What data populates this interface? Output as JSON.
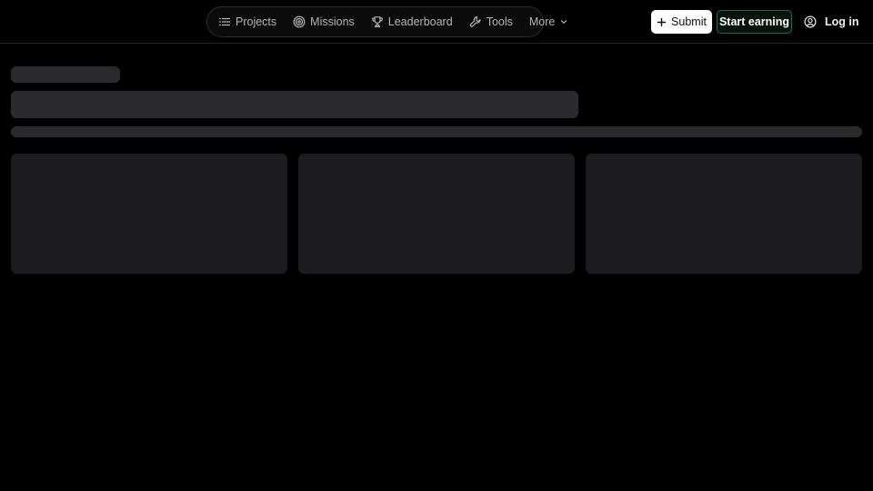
{
  "nav": {
    "items": [
      {
        "label": "Projects",
        "icon": "list-icon"
      },
      {
        "label": "Missions",
        "icon": "target-icon"
      },
      {
        "label": "Leaderboard",
        "icon": "trophy-icon"
      },
      {
        "label": "Tools",
        "icon": "wrench-icon"
      },
      {
        "label": "More",
        "icon": "chevron-down-icon"
      }
    ]
  },
  "actions": {
    "submit_label": "Submit",
    "start_earning_label": "Start earning",
    "login_label": "Log in"
  },
  "colors": {
    "background": "#000000",
    "accent_green_border": "#1f6b47",
    "skeleton": "#2a2a2c"
  }
}
